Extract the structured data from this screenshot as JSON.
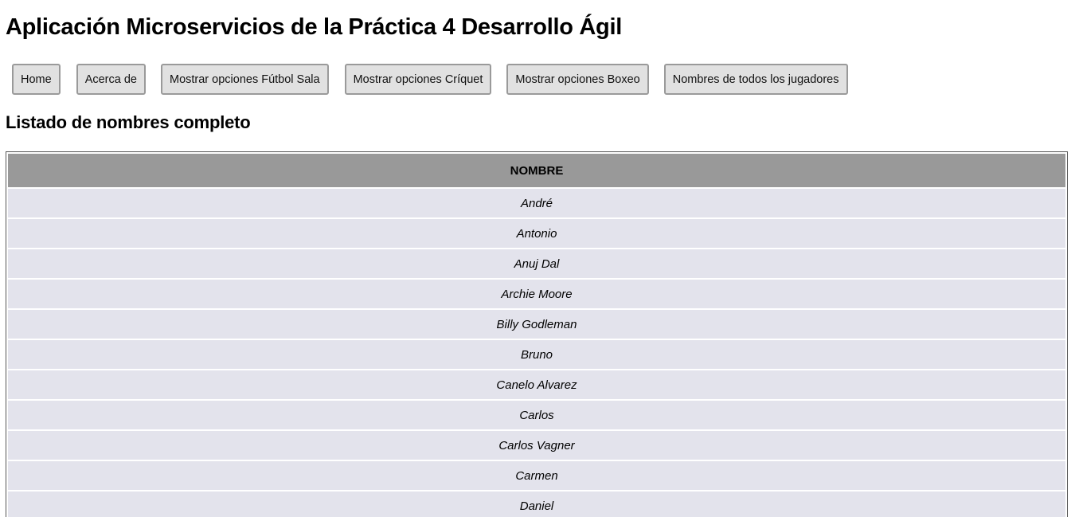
{
  "header": {
    "title": "Aplicación Microservicios de la Práctica 4 Desarrollo Ágil"
  },
  "nav": {
    "items": [
      {
        "label": "Home"
      },
      {
        "label": "Acerca de"
      },
      {
        "label": "Mostrar opciones Fútbol Sala"
      },
      {
        "label": "Mostrar opciones Críquet"
      },
      {
        "label": "Mostrar opciones Boxeo"
      },
      {
        "label": "Nombres de todos los jugadores"
      }
    ]
  },
  "main": {
    "section_title": "Listado de nombres completo",
    "table": {
      "column_header": "NOMBRE",
      "rows": [
        "André",
        "Antonio",
        "Anuj Dal",
        "Archie Moore",
        "Billy Godleman",
        "Bruno",
        "Canelo Alvarez",
        "Carlos",
        "Carlos Vagner",
        "Carmen",
        "Daniel"
      ]
    }
  }
}
